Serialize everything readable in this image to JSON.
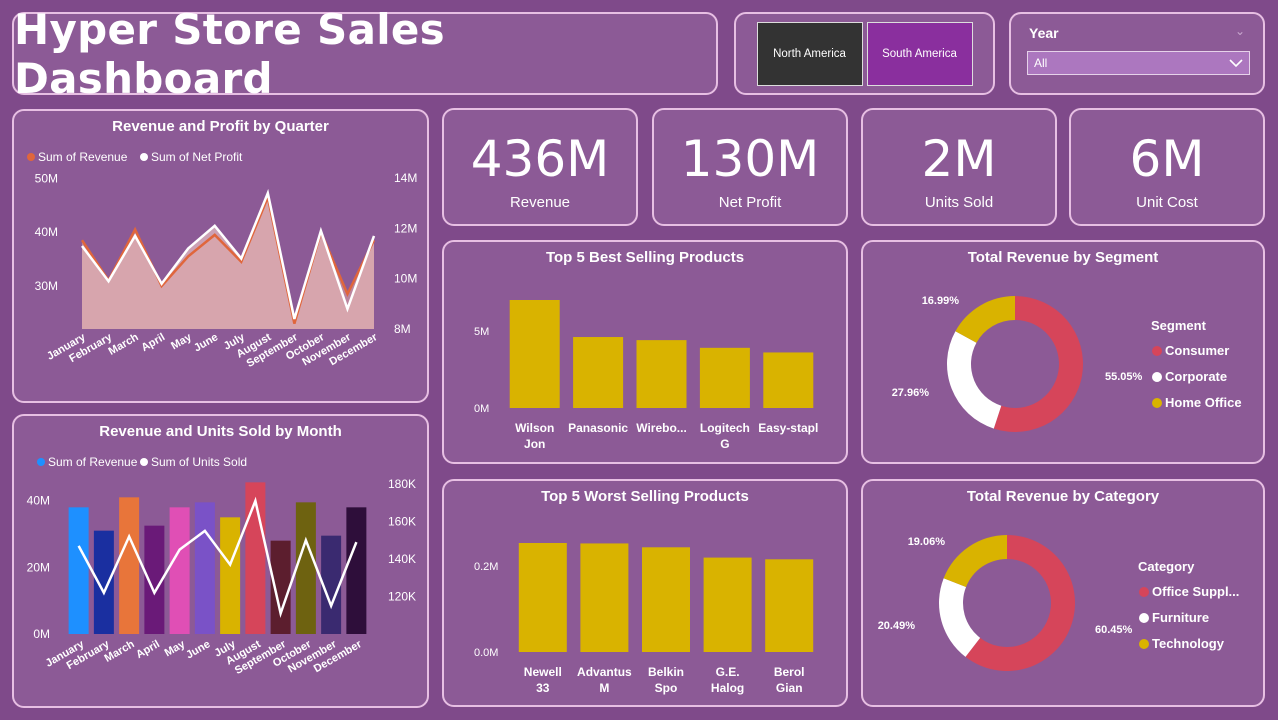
{
  "header": {
    "title": "Hyper Store Sales Dashboard"
  },
  "region_filter": {
    "options": [
      "North America",
      "South America"
    ],
    "selected": "South America"
  },
  "year_filter": {
    "label": "Year",
    "value": "All"
  },
  "kpis": [
    {
      "value": "436M",
      "label": "Revenue"
    },
    {
      "value": "130M",
      "label": "Net Profit"
    },
    {
      "value": "2M",
      "label": "Units Sold"
    },
    {
      "value": "6M",
      "label": "Unit Cost"
    }
  ],
  "colors": {
    "revenue_line": "#e0663c",
    "profit_line": "#ffffff",
    "bar_gold": "#d9b300",
    "consumer": "#d6455a",
    "corporate": "#ffffff",
    "home_office": "#d9b300"
  },
  "chart_data": [
    {
      "type": "line",
      "title": "Revenue and Profit by Quarter",
      "x": [
        "January",
        "February",
        "March",
        "April",
        "May",
        "June",
        "July",
        "August",
        "September",
        "October",
        "November",
        "December"
      ],
      "series": [
        {
          "name": "Sum of Revenue",
          "axis": "left",
          "values": [
            38.5,
            31,
            40.5,
            30,
            35.5,
            39.5,
            34.5,
            46.5,
            23,
            40,
            28.5,
            38.5
          ]
        },
        {
          "name": "Sum of Net Profit",
          "axis": "right",
          "values": [
            11.3,
            9.9,
            11.7,
            9.8,
            11.2,
            12.1,
            10.8,
            13.4,
            8.4,
            11.9,
            8.8,
            11.7
          ]
        }
      ],
      "yticks_left": [
        "30M",
        "40M",
        "50M"
      ],
      "yticks_right": [
        "8M",
        "10M",
        "12M",
        "14M"
      ],
      "ylim_left": [
        22,
        51
      ],
      "ylim_right": [
        8,
        14.2
      ],
      "legend": "top-left"
    },
    {
      "type": "bar",
      "title": "Revenue and Units Sold by Month",
      "categories": [
        "January",
        "February",
        "March",
        "April",
        "May",
        "June",
        "July",
        "August",
        "September",
        "October",
        "November",
        "December"
      ],
      "series": [
        {
          "name": "Sum of Revenue",
          "axis": "left",
          "values": [
            38,
            31,
            41,
            32.5,
            38,
            39.5,
            35,
            45.5,
            28,
            39.5,
            29.5,
            38
          ]
        },
        {
          "name": "Sum of Units Sold",
          "axis": "right",
          "type": "line",
          "values": [
            147,
            122,
            152,
            122,
            145,
            155,
            137,
            171,
            111,
            150,
            115,
            149
          ]
        }
      ],
      "bar_colors": [
        "#1e90ff",
        "#1a2fa0",
        "#e8753a",
        "#6a1a78",
        "#e04fb5",
        "#7a52c7",
        "#d9b300",
        "#d6455a",
        "#5c1e2e",
        "#6e6210",
        "#3a2a70",
        "#2e0e3a"
      ],
      "yticks_left": [
        "0M",
        "20M",
        "40M"
      ],
      "yticks_right": [
        "120K",
        "140K",
        "160K",
        "180K"
      ],
      "ylim_left": [
        0,
        45
      ],
      "ylim_right": [
        100,
        180
      ],
      "legend": "top-left"
    },
    {
      "type": "bar",
      "title": "Top 5 Best Selling Products",
      "categories": [
        [
          "Wilson",
          "Jon"
        ],
        [
          "Panasonic"
        ],
        [
          "Wirebo..."
        ],
        [
          "Logitech",
          "G"
        ],
        [
          "Easy-stapl"
        ]
      ],
      "values": [
        7,
        4.6,
        4.4,
        3.9,
        3.6
      ],
      "yticks": [
        "0M",
        "5M"
      ],
      "ylim": [
        0,
        7
      ]
    },
    {
      "type": "bar",
      "title": "Top 5 Worst Selling Products",
      "categories": [
        [
          "Newell",
          "33"
        ],
        [
          "Advantus",
          "M"
        ],
        [
          "Belkin",
          "Spo"
        ],
        [
          "G.E.",
          "Halog"
        ],
        [
          "Berol",
          "Gian"
        ]
      ],
      "values": [
        0.254,
        0.253,
        0.244,
        0.22,
        0.216
      ],
      "yticks": [
        "0.0M",
        "0.2M"
      ],
      "ylim": [
        0,
        0.254
      ]
    },
    {
      "type": "pie",
      "title": "Total Revenue by Segment",
      "legend_title": "Segment",
      "labels": [
        "Consumer",
        "Corporate",
        "Home Office"
      ],
      "values": [
        55.05,
        27.96,
        16.99
      ],
      "value_labels": [
        "55.05%",
        "27.96%",
        "16.99%"
      ],
      "legend": "right"
    },
    {
      "type": "pie",
      "title": "Total Revenue by Category",
      "legend_title": "Category",
      "labels": [
        "Office Suppl...",
        "Furniture",
        "Technology"
      ],
      "values": [
        60.45,
        20.49,
        19.06
      ],
      "value_labels": [
        "60.45%",
        "20.49%",
        "19.06%"
      ],
      "legend": "right"
    }
  ]
}
